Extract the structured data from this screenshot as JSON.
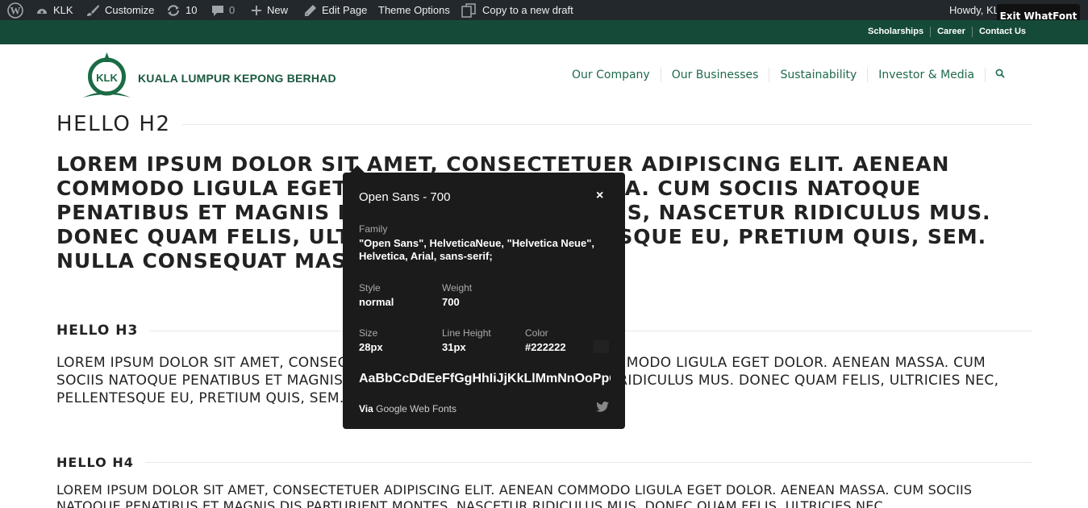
{
  "adminbar": {
    "site_name": "KLK",
    "customize": "Customize",
    "updates_count": "10",
    "comments_count": "0",
    "new_label": "New",
    "edit_page": "Edit Page",
    "theme_options": "Theme Options",
    "copy_draft": "Copy to a new draft",
    "howdy": "Howdy, KLK Admin",
    "exit_whatfont": "Exit WhatFont"
  },
  "toplinks": [
    "Scholarships",
    "Career",
    "Contact Us"
  ],
  "logo": {
    "text": "KUALA LUMPUR KEPONG BERHAD",
    "brand_color": "#1b5a3f"
  },
  "nav": [
    "Our Company",
    "Our Businesses",
    "Sustainability",
    "Investor & Media"
  ],
  "content": {
    "h2": "HELLO H2",
    "p_h2": "LOREM IPSUM DOLOR SIT AMET, CONSECTETUER ADIPISCING ELIT. AENEAN COMMODO LIGULA EGET DOLOR. AENEAN MASSA. CUM SOCIIS NATOQUE PENATIBUS ET MAGNIS DIS PARTURIENT MONTES, NASCETUR RIDICULUS MUS. DONEC QUAM FELIS, ULTRICIES NEC, PELLENTESQUE EU, PRETIUM QUIS, SEM. NULLA CONSEQUAT MASSA QUIS ENIM.",
    "h3": "HELLO H3",
    "p_h3": "LOREM IPSUM DOLOR SIT AMET, CONSECTETUER ADIPISCING ELIT. AENEAN COMMODO LIGULA EGET DOLOR. AENEAN MASSA. CUM SOCIIS NATOQUE PENATIBUS ET MAGNIS DIS PARTURIENT MONTES, NASCETUR RIDICULUS MUS. DONEC QUAM FELIS, ULTRICIES NEC, PELLENTESQUE EU, PRETIUM QUIS, SEM. NULLA CONSEQUAT MASSA QUIS ENIM.",
    "h4": "HELLO H4",
    "p_h4": "LOREM IPSUM DOLOR SIT AMET, CONSECTETUER ADIPISCING ELIT. AENEAN COMMODO LIGULA EGET DOLOR. AENEAN MASSA. CUM SOCIIS NATOQUE PENATIBUS ET MAGNIS DIS PARTURIENT MONTES, NASCETUR RIDICULUS MUS. DONEC QUAM FELIS, ULTRICIES NEC"
  },
  "whatfont": {
    "title": "Open Sans - 700",
    "close": "×",
    "family_label": "Family",
    "family_value": "\"Open Sans\", HelveticaNeue, \"Helvetica Neue\", Helvetica, Arial, sans-serif;",
    "style_label": "Style",
    "style_value": "normal",
    "weight_label": "Weight",
    "weight_value": "700",
    "size_label": "Size",
    "size_value": "28px",
    "line_height_label": "Line Height",
    "line_height_value": "31px",
    "color_label": "Color",
    "color_value": "#222222",
    "sample": "AaBbCcDdEeFfGgHhIiJjKkLlMmNnOoPpQ",
    "via_prefix": "Via",
    "via_source": "Google Web Fonts"
  },
  "colors": {
    "adminbar_bg": "#23282d",
    "topbar_bg": "#154a38",
    "nav_text": "#1e6a4b",
    "panel_bg": "#1b1b1b"
  }
}
